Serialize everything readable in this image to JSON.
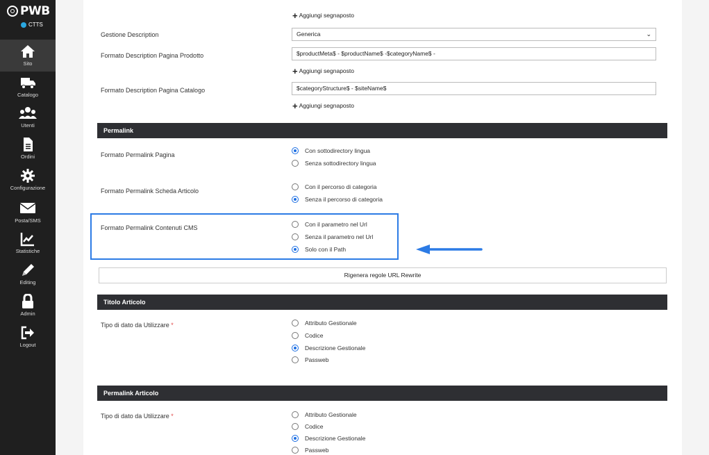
{
  "sidebar": {
    "logo": "PWB",
    "site_name": "CTTS",
    "items": [
      {
        "label": "Sito",
        "icon": "home-icon"
      },
      {
        "label": "Catalogo",
        "icon": "truck-icon"
      },
      {
        "label": "Utenti",
        "icon": "users-icon"
      },
      {
        "label": "Ordini",
        "icon": "document-icon"
      },
      {
        "label": "Configurazione",
        "icon": "gear-icon"
      },
      {
        "label": "Posta/SMS",
        "icon": "envelope-icon"
      },
      {
        "label": "Statistiche",
        "icon": "chart-icon"
      },
      {
        "label": "Editing",
        "icon": "pencil-icon"
      },
      {
        "label": "Admin",
        "icon": "lock-icon"
      },
      {
        "label": "Logout",
        "icon": "logout-icon"
      }
    ]
  },
  "add_placeholder_label": "Aggiungi segnaposto",
  "description": {
    "gestione_label": "Gestione Description",
    "gestione_value": "Generica",
    "prodotto_label": "Formato Description Pagina Prodotto",
    "prodotto_value": "$productMeta$ - $productName$ -$categoryName$ -",
    "catalogo_label": "Formato Description Pagina Catalogo",
    "catalogo_value": "$categoryStructure$ - $siteName$"
  },
  "permalink": {
    "section_title": "Permalink",
    "pagina": {
      "label": "Formato Permalink Pagina",
      "options": [
        "Con sottodirectory lingua",
        "Senza sottodirectory lingua"
      ],
      "selected": 0
    },
    "scheda": {
      "label": "Formato Permalink Scheda Articolo",
      "options": [
        "Con il percorso di categoria",
        "Senza il percorso di categoria"
      ],
      "selected": 1
    },
    "cms": {
      "label": "Formato Permalink Contenuti CMS",
      "options": [
        "Con il parametro nel Url",
        "Senza il parametro nel Url",
        "Solo con il Path"
      ],
      "selected": 2
    },
    "regen_button": "Rigenera regole URL Rewrite"
  },
  "titolo_articolo": {
    "section_title": "Titolo Articolo",
    "label": "Tipo di dato da Utilizzare",
    "required_mark": "*",
    "options": [
      "Attributo Gestionale",
      "Codice",
      "Descrizione Gestionale",
      "Passweb"
    ],
    "selected": 2
  },
  "permalink_articolo": {
    "section_title": "Permalink Articolo",
    "label": "Tipo di dato da Utilizzare",
    "required_mark": "*",
    "options": [
      "Attributo Gestionale",
      "Codice",
      "Descrizione Gestionale",
      "Passweb"
    ],
    "selected": 2
  },
  "colors": {
    "sidebar_bg": "#1f1f1f",
    "section_bg": "#2e2f33",
    "accent": "#1d6fe3",
    "highlight": "#2c7be5"
  }
}
